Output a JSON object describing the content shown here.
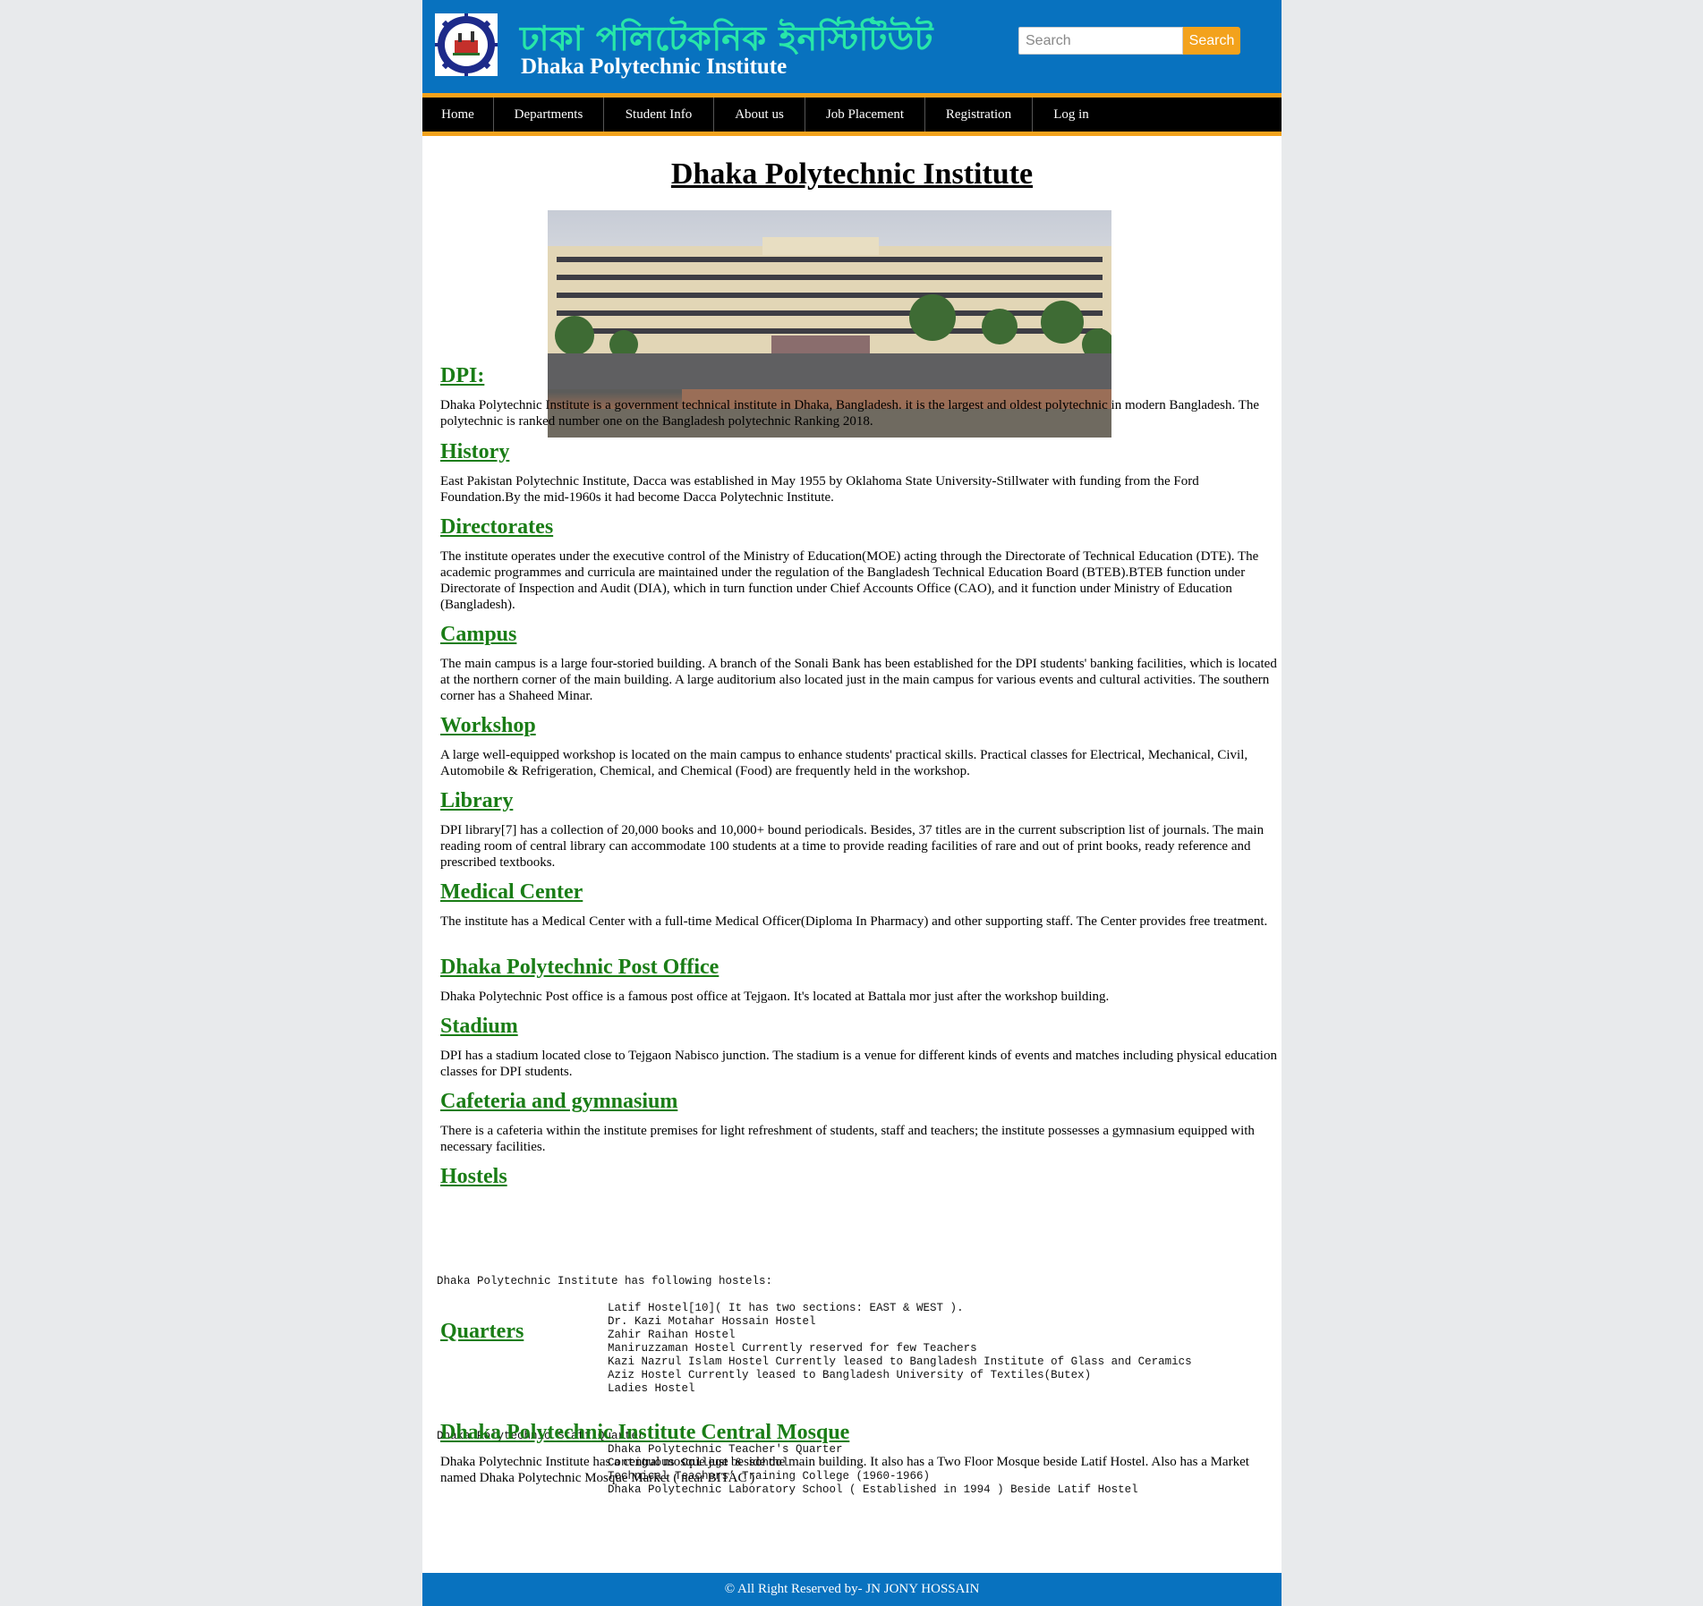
{
  "header": {
    "logo": "dhaka-polytechnic-gear-logo",
    "title_bn": "ঢাকা পলিটেকনিক ইনস্টিটিউট",
    "title_en": "Dhaka Polytechnic Institute",
    "search_placeholder": "Search",
    "search_button": "Search"
  },
  "colors": {
    "brand_blue": "#0872bf",
    "accent_orange": "#f3a21c",
    "heading_green": "#1a7d16",
    "title_green": "#28e6a9"
  },
  "nav": {
    "items": [
      {
        "label": "Home"
      },
      {
        "label": "Departments"
      },
      {
        "label": "Student Info"
      },
      {
        "label": "About us"
      },
      {
        "label": "Job Placement"
      },
      {
        "label": "Registration"
      },
      {
        "label": "Log in"
      }
    ]
  },
  "main": {
    "title": "Dhaka Polytechnic Institute",
    "sections": [
      {
        "heading": "DPI:",
        "text": "Dhaka Polytechnic Institute is a government technical institute in Dhaka, Bangladesh. it is the largest and oldest polytechnic in modern Bangladesh. The polytechnic is ranked number one on the Bangladesh polytechnic Ranking 2018."
      },
      {
        "heading": "History",
        "text": "East Pakistan Polytechnic Institute, Dacca was established in May 1955 by Oklahoma State University-Stillwater with funding from the Ford Foundation.By the mid-1960s it had become Dacca Polytechnic Institute."
      },
      {
        "heading": "Directorates",
        "text": "The institute operates under the executive control of the Ministry of Education(MOE) acting through the Directorate of Technical Education (DTE). The academic programmes and curricula are maintained under the regulation of the Bangladesh Technical Education Board (BTEB).BTEB function under Directorate of Inspection and Audit (DIA), which in turn function under Chief Accounts Office (CAO), and it function under Ministry of Education (Bangladesh)."
      },
      {
        "heading": "Campus",
        "text": "The main campus is a large four-storied building. A branch of the Sonali Bank has been established for the DPI students' banking facilities, which is located at the northern corner of the main building. A large auditorium also located just in the main campus for various events and cultural activities. The southern corner has a Shaheed Minar."
      },
      {
        "heading": "Workshop",
        "text": "A large well-equipped workshop is located on the main campus to enhance students' practical skills. Practical classes for Electrical, Mechanical, Civil, Automobile & Refrigeration, Chemical, and Chemical (Food) are frequently held in the workshop."
      },
      {
        "heading": "Library",
        "text": "DPI library[7] has a collection of 20,000 books and 10,000+ bound periodicals. Besides, 37 titles are in the current subscription list of journals. The main reading room of central library can accommodate 100 students at a time to provide reading facilities of rare and out of print books, ready reference and prescribed textbooks."
      },
      {
        "heading": "Medical Center",
        "text": "The institute has a Medical Center with a full-time Medical Officer(Diploma In Pharmacy) and other supporting staff. The Center provides free treatment."
      },
      {
        "heading": "Dhaka Polytechnic Post Office",
        "text": "Dhaka Polytechnic Post office is a famous post office at Tejgaon. It's located at Battala mor just after the workshop building."
      },
      {
        "heading": "Stadium",
        "text": "DPI has a stadium located close to Tejgaon Nabisco junction. The stadium is a venue for different kinds of events and matches including physical education classes for DPI students."
      },
      {
        "heading": "Cafeteria and gymnasium",
        "text": "There is a cafeteria within the institute premises for light refreshment of students, staff and teachers; the institute possesses a gymnasium equipped with necessary facilities."
      }
    ],
    "hostels": {
      "heading": "Hostels",
      "intro": "Dhaka Polytechnic Institute has following hostels:",
      "items": [
        "Latif Hostel[10]( It has two sections: EAST & WEST ).",
        "Dr. Kazi Motahar Hossain Hostel",
        "Zahir Raihan Hostel",
        "Maniruzzaman Hostel Currently reserved for few Teachers",
        "Kazi Nazrul Islam Hostel Currently leased to Bangladesh Institute of Glass and Ceramics",
        "Aziz Hostel Currently leased to Bangladesh University of Textiles(Butex)",
        "Ladies Hostel"
      ]
    },
    "quarters": {
      "heading": "Quarters",
      "first": "Dhaka Polytechnic Staff Quarter",
      "items": [
        "Dhaka Polytechnic Teacher's Quarter",
        "Contiguous College & school",
        "Technical Teachers’ Training College (1960-1966)",
        "Dhaka Polytechnic Laboratory School ( Established in 1994 ) Beside Latif Hostel"
      ]
    },
    "mosque": {
      "heading": "Dhaka Polytechnic Institute Central Mosque",
      "text": "Dhaka Polytechnic Institute has a central mosque just beside the main building. It also has a Two Floor Mosque beside Latif Hostel. Also has a Market named Dhaka Polytechnic Mosque Market ( near BITAC )"
    }
  },
  "footer": {
    "text": "© All Right Reserved by- JN JONY HOSSAIN"
  }
}
